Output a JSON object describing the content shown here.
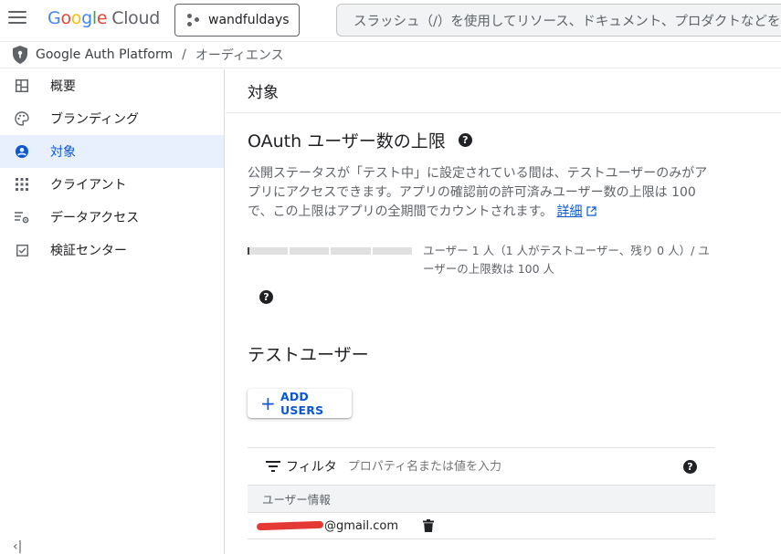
{
  "header": {
    "logo_google": [
      "G",
      "o",
      "o",
      "g",
      "l",
      "e"
    ],
    "logo_cloud": "Cloud",
    "project_name": "wandfuldays",
    "search_placeholder": "スラッシュ（/）を使用してリソース、ドキュメント、プロダクトなどを検索"
  },
  "breadcrumb": {
    "product": "Google Auth Platform",
    "separator": "/",
    "current": "オーディエンス"
  },
  "sidebar": {
    "items": [
      {
        "label": "概要",
        "icon": "dashboard-icon"
      },
      {
        "label": "ブランディング",
        "icon": "palette-icon"
      },
      {
        "label": "対象",
        "icon": "account-circle-icon",
        "active": true
      },
      {
        "label": "クライアント",
        "icon": "apps-grid-icon"
      },
      {
        "label": "データアクセス",
        "icon": "data-settings-icon"
      },
      {
        "label": "検証センター",
        "icon": "check-box-icon"
      }
    ],
    "collapse_glyph": "‹|"
  },
  "main": {
    "page_title": "対象",
    "limit": {
      "title": "OAuth ユーザー数の上限",
      "description": "公開ステータスが「テスト中」に設定されている間は、テストユーザーのみがアプリにアクセスできます。アプリの確認前の許可済みユーザー数の上限は 100 で、この上限はアプリの全期間でカウントされます。",
      "details_link": "詳細",
      "usage_text": "ユーザー 1 人（1 人がテストユーザー、残り 0 人）/ ユーザーの上限数は 100 人",
      "usage_current": 1,
      "usage_max": 100
    },
    "test_users": {
      "title": "テストユーザー",
      "add_button": "ADD USERS",
      "filter_label": "フィルタ",
      "filter_placeholder": "プロパティ名または値を入力",
      "column_header": "ユーザー情報",
      "rows": [
        {
          "email_visible": "@gmail.com"
        }
      ]
    },
    "help_glyph": "?"
  },
  "colors": {
    "accent": "#0b57d0",
    "active_bg": "#e8f0fe",
    "redaction": "#e53935"
  }
}
